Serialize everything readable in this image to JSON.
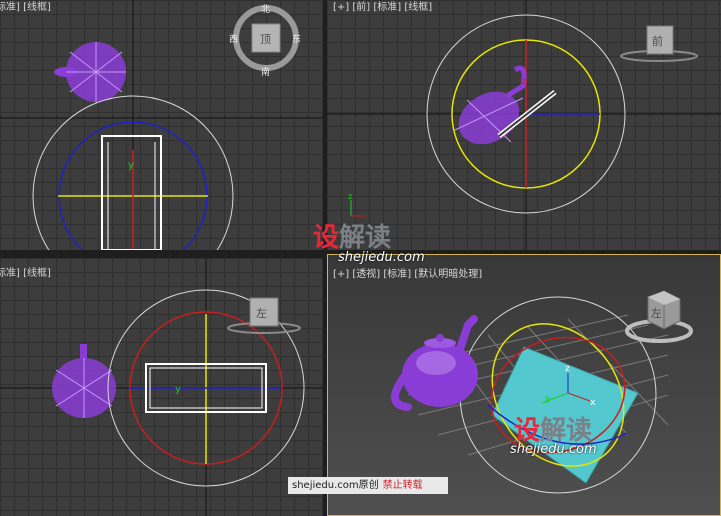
{
  "viewports": {
    "top": {
      "label": "[+] [顶] [标准] [线框]",
      "visible_label": "标准] [线框]",
      "compass": {
        "n": "北",
        "s": "南",
        "e": "东",
        "w": "西",
        "cube_face": "顶"
      }
    },
    "front": {
      "label": "[+] [前] [标准] [线框]",
      "cube_face": "前"
    },
    "left": {
      "label": "标准] [线框]",
      "cube_face": "左"
    },
    "perspective": {
      "label": "[+] [透视] [标准] [默认明暗处理]",
      "cube_face": "左"
    }
  },
  "axis_labels": {
    "x": "x",
    "y": "y",
    "z": "z"
  },
  "watermarks": {
    "brand_part1": "设",
    "brand_part2": "解读",
    "site": "shejiedu.com"
  },
  "credit": {
    "site": "shejiedu.com",
    "original": "原创",
    "forbidden": "禁止转载"
  },
  "colors": {
    "teapot": "#8a3dd6",
    "gizmo_white": "#d8d8d8",
    "circle_blue": "#2020c8",
    "circle_yellow": "#e6e600",
    "circle_red": "#c81e1e",
    "plane": "#54c8cf",
    "active_border": "#d2b55a"
  }
}
